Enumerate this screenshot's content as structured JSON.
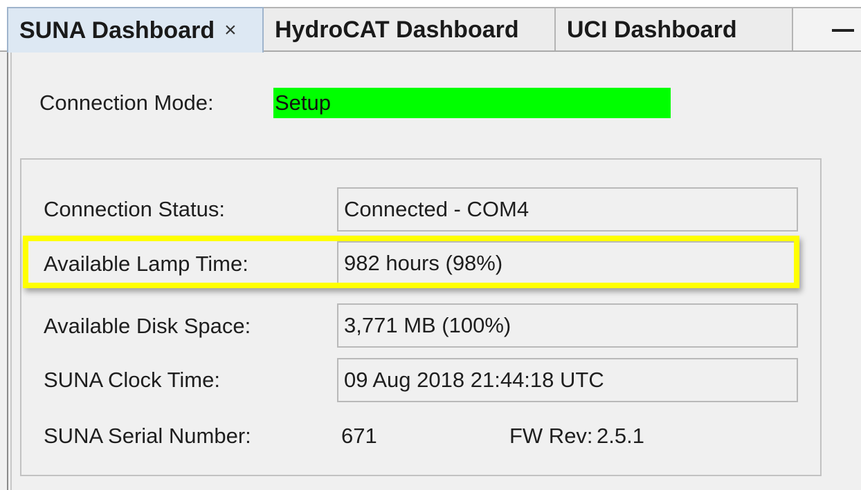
{
  "tabs": [
    {
      "label": "SUNA Dashboard",
      "active": true,
      "closable": true
    },
    {
      "label": "HydroCAT Dashboard",
      "active": false
    },
    {
      "label": "UCI Dashboard",
      "active": false
    }
  ],
  "close_glyph": "×",
  "connection_mode": {
    "label": "Connection Mode:",
    "value": "Setup",
    "color": "#00ff00"
  },
  "status": {
    "connection_status": {
      "label": "Connection  Status:",
      "value": "Connected - COM4"
    },
    "lamp_time": {
      "label": "Available Lamp Time:",
      "value": "982 hours (98%)"
    },
    "disk_space": {
      "label": "Available Disk Space:",
      "value": "3,771 MB (100%)"
    },
    "clock_time": {
      "label": "SUNA Clock Time:",
      "value": "09 Aug 2018 21:44:18 UTC"
    },
    "serial_number": {
      "label": "SUNA Serial Number:",
      "value": "671"
    },
    "fw_rev": {
      "label": "FW Rev:",
      "value": "2.5.1"
    }
  },
  "highlight_color": "#ffff00",
  "icons": {
    "minimize": "minimize-icon",
    "close": "close-icon"
  }
}
